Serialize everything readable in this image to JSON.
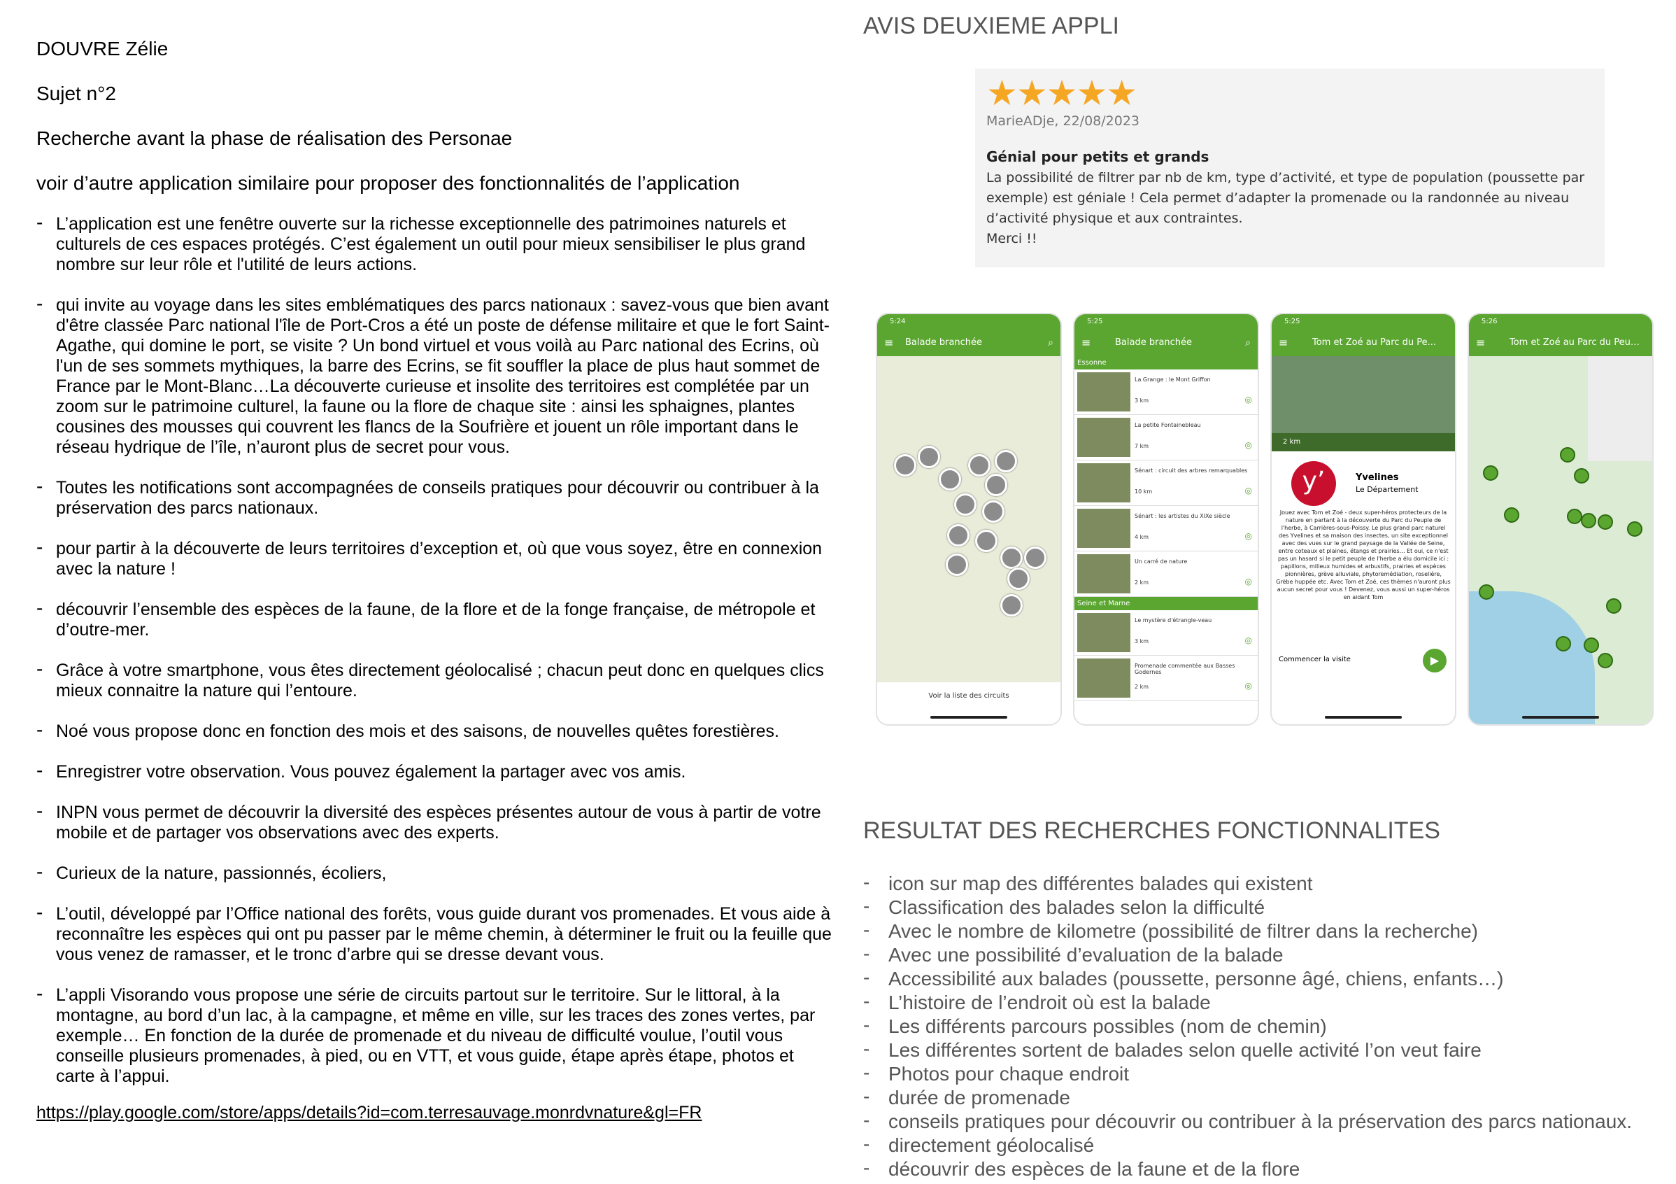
{
  "left": {
    "author": "DOUVRE Zélie",
    "subject": "Sujet n°2",
    "heading": "Recherche avant la phase de réalisation des Personae",
    "intro": "voir d’autre application similaire pour proposer des fonctionnalités de l’application",
    "bullets": [
      "L’application est une fenêtre ouverte sur la richesse exceptionnelle des patrimoines naturels et culturels de ces espaces protégés. C’est également un outil pour mieux sensibiliser le plus grand nombre sur leur rôle et l'utilité de leurs actions.",
      "qui invite au voyage dans les sites emblématiques des parcs nationaux : savez-vous que bien avant d'être classée Parc national l'île de Port-Cros a été un poste de défense militaire et que le fort Saint-Agathe, qui domine le port, se visite ? Un bond virtuel et vous voilà au Parc national des Ecrins, où l'un de ses sommets mythiques, la barre des Ecrins, se fit souffler la place de plus haut sommet de France par le Mont-Blanc…La découverte curieuse et insolite des territoires est complétée par un zoom sur le patrimoine culturel, la faune ou la flore de chaque site : ainsi les sphaignes, plantes cousines des mousses qui couvrent les flancs de la Soufrière et jouent un rôle important dans le réseau hydrique de l’île, n’auront plus de secret pour vous.",
      "Toutes les notifications sont accompagnées de conseils pratiques pour découvrir ou contribuer à la préservation des parcs nationaux.",
      "pour partir à la découverte de leurs territoires d’exception et, où que vous soyez, être en connexion avec la nature !",
      "découvrir l’ensemble des espèces de la faune, de la flore et de la fonge française, de métropole et d’outre-mer.",
      "Grâce à votre smartphone, vous êtes directement géolocalisé ; chacun peut donc en quelques clics mieux connaitre la nature qui l’entoure.",
      "Noé vous propose donc en fonction des mois et des saisons, de nouvelles quêtes forestières.",
      "Enregistrer votre observation. Vous pouvez également la partager avec vos amis.",
      "INPN vous permet de découvrir la diversité des espèces présentes autour de vous à partir de votre mobile et de partager vos observations avec des experts.",
      "Curieux de la nature, passionnés, écoliers,",
      "L’outil, développé par l’Office national des forêts, vous guide durant vos promenades. Et vous aide à reconnaître les espèces qui ont pu passer par le même chemin, à déterminer le fruit ou la feuille que vous venez de ramasser, et le tronc d’arbre qui se dresse devant vous.",
      "L’appli Visorando vous propose une série de circuits partout sur le territoire. Sur le littoral, à la montagne, au bord d’un lac, à la campagne, et même en ville, sur les traces des zones vertes, par exemple… En fonction de la durée de promenade et du niveau de difficulté voulue, l’outil vous conseille plusieurs promenades, à pied, ou en VTT, et vous guide, étape après étape, photos et carte à l’appui."
    ],
    "link": "https://play.google.com/store/apps/details?id=com.terresauvage.monrdvnature&gl=FR"
  },
  "right": {
    "title_review": "AVIS DEUXIEME APPLI",
    "review": {
      "stars": "★★★★★",
      "meta": "MarieADje, 22/08/2023",
      "title": "Génial pour petits et grands",
      "body": "La possibilité de filtrer par nb de km, type d’activité, et type de population (poussette par exemple) est géniale ! Cela permet d’adapter la promenade ou la randonnée au niveau d’activité physique et aux contraintes.",
      "thanks": "Merci !!"
    },
    "phones": [
      {
        "time": "5:24",
        "title": "Balade branchée",
        "footer": "Voir la liste des circuits"
      },
      {
        "time": "5:25",
        "title": "Balade branchée",
        "section1": "Essonne",
        "section2": "Seine et Marne",
        "items": [
          {
            "name": "La Grange : le Mont Griffon",
            "km": "3 km"
          },
          {
            "name": "La petite Fontainebleau",
            "km": "7 km"
          },
          {
            "name": "Sénart : circuit des arbres remarquables",
            "km": "10 km"
          },
          {
            "name": "Sénart : les artistes du XIXe siècle",
            "km": "4 km"
          },
          {
            "name": "Un carré de nature",
            "km": "2 km"
          },
          {
            "name": "Le mystère d'étrangle-veau",
            "km": "3 km"
          },
          {
            "name": "Promenade commentée aux Basses Godernes",
            "km": "2 km"
          }
        ]
      },
      {
        "time": "5:25",
        "title": "Tom et Zoé au Parc du Pe...",
        "distance": "2 km",
        "brand": "Yvelines",
        "brand_sub": "Le Département",
        "text": "Jouez avec Tom et Zoé - deux super-héros protecteurs de la nature en partant à la découverte du Parc du Peuple de l'herbe, à Carrières-sous-Poissy. Le plus grand parc naturel des Yvelines et sa maison des insectes, un site exceptionnel avec des vues sur le grand paysage de la Vallée de Seine, entre coteaux et plaines, étangs et prairies… Et oui, ce n'est pas un hasard si le petit peuple de l'herbe a élu domicile ici : papillons, milieux humides et arbustifs, prairies et espèces pionnières, grève alluviale, phytoremédiation, roselière, Grèbe huppée etc. Avec Tom et Zoé, ces thèmes n'auront plus aucun secret pour vous ! Devenez, vous aussi un super-héros en aidant Tom",
        "cta": "Commencer la visite"
      },
      {
        "time": "5:26",
        "title": "Tom et Zoé au Parc du Peuple..."
      }
    ],
    "title_results": "RESULTAT DES RECHERCHES FONCTIONNALITES",
    "results": [
      "icon sur map des différentes balades qui existent",
      "Classification des balades selon la difficulté",
      "Avec le nombre de kilometre (possibilité de filtrer dans la recherche)",
      "Avec une possibilité d’evaluation de la balade",
      "Accessibilité aux balades (poussette, personne âgé, chiens, enfants…)",
      "L’histoire de l’endroit où est la balade",
      "Les différents parcours possibles (nom de chemin)",
      "Les différentes sortent de balades selon quelle activité l’on veut faire",
      "Photos pour chaque endroit",
      "durée de promenade",
      "conseils pratiques pour découvrir ou contribuer à la préservation des parcs nationaux.",
      "directement géolocalisé",
      "découvrir des espèces de la faune et de la flore"
    ]
  }
}
